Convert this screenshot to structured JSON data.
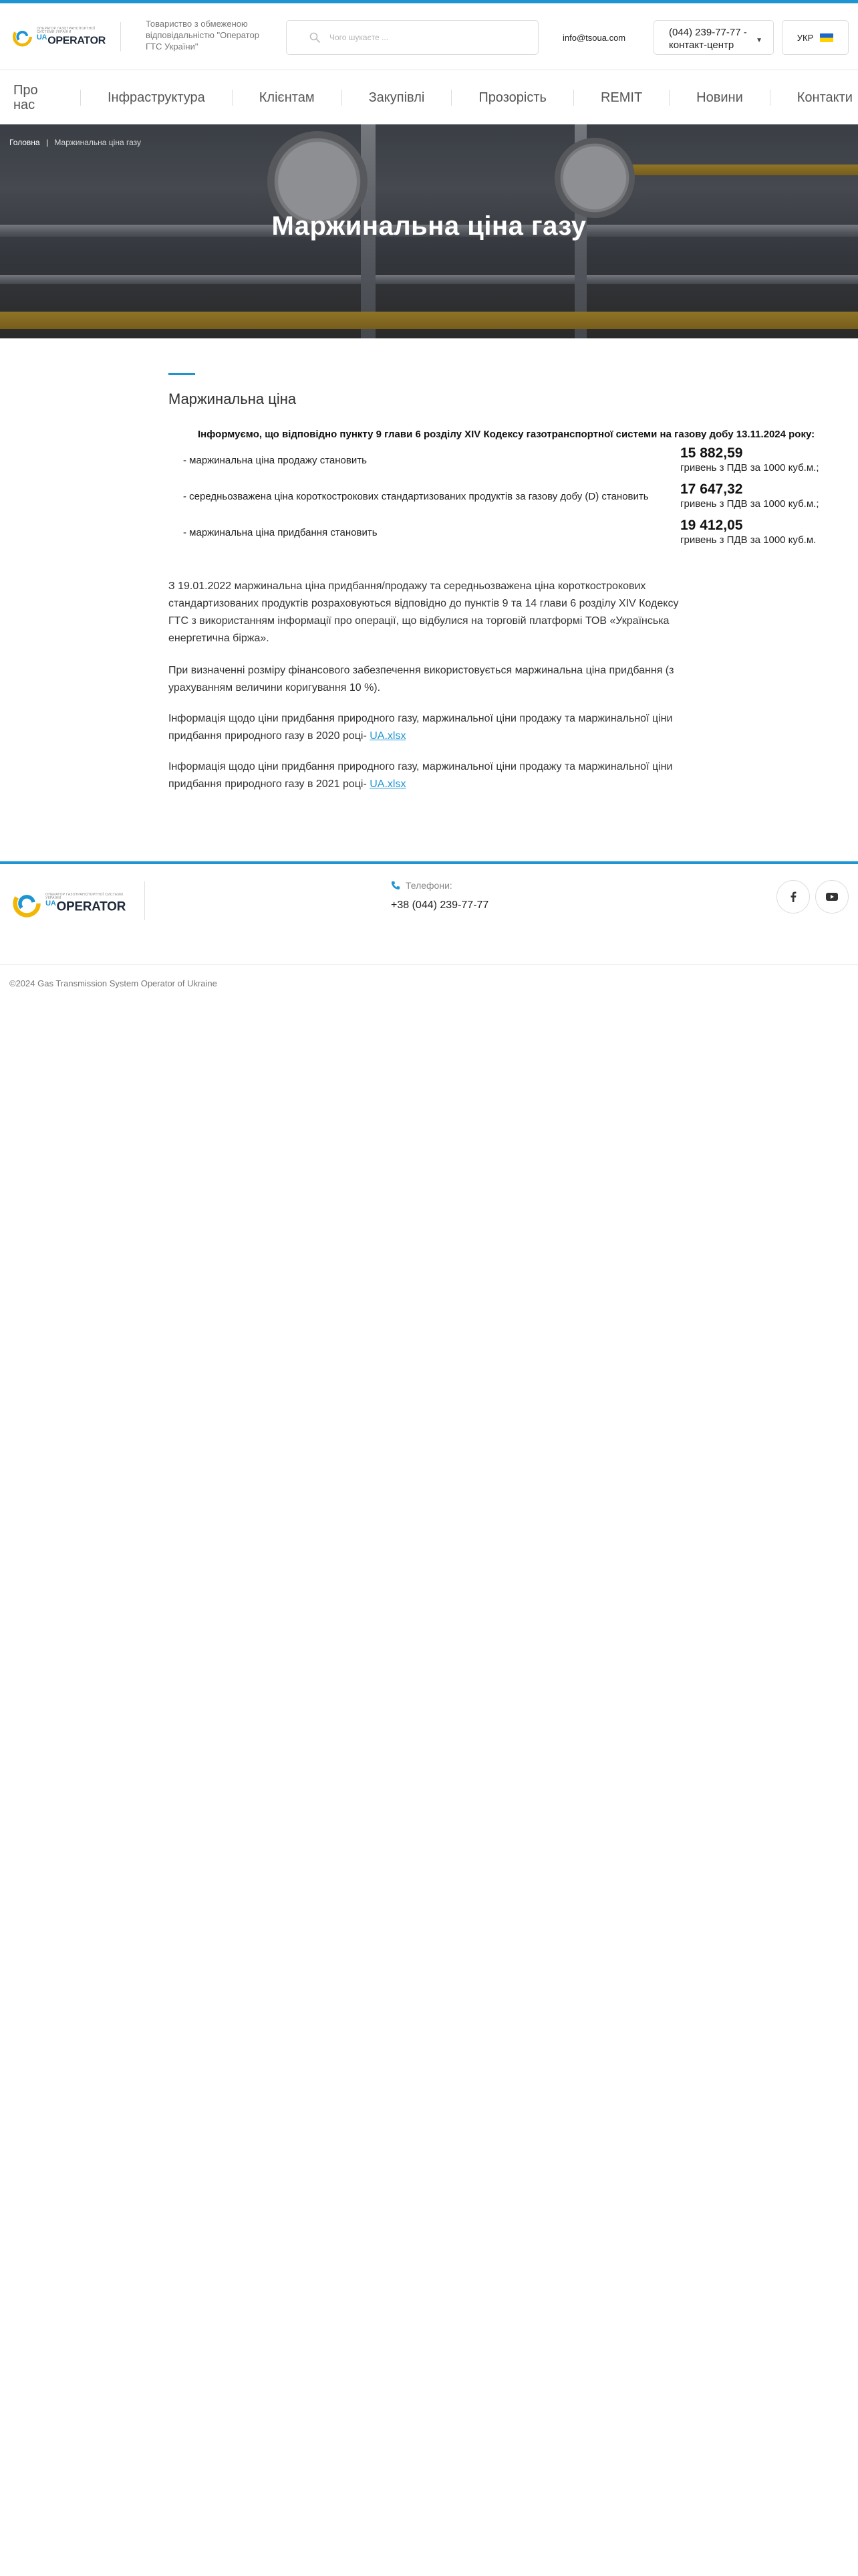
{
  "header": {
    "logo_small": "ОПЕРАТОР ГАЗОТРАНСПОРТНОЇ СИСТЕМИ УКРАЇНИ",
    "logo_ua": "UA",
    "logo_main": "OPERATOR",
    "company_name": "Товариство з обмеженою відповідальністю \"Оператор ГТС України\"",
    "search_placeholder": "Чого шукаєте ...",
    "email": "info@tsoua.com",
    "contact_label": "(044) 239-77-77 - контакт-центр",
    "language": "УКР"
  },
  "nav": {
    "items": [
      "Про нас",
      "Інфраструктура",
      "Клієнтам",
      "Закупівлі",
      "Прозорість",
      "REMIT",
      "Новини",
      "Контакти"
    ]
  },
  "hero": {
    "breadcrumb_home": "Головна",
    "breadcrumb_sep": "|",
    "breadcrumb_current": "Маржинальна ціна газу",
    "title": "Маржинальна ціна газу"
  },
  "content": {
    "section_title": "Маржинальна ціна",
    "intro": "Інформуємо, що відповідно пункту 9 глави 6 розділу XIV Кодексу газотранспортної системи на газову добу 13.11.2024 року:",
    "prices": [
      {
        "label": "- маржинальна ціна продажу становить",
        "value": "15 882,59",
        "unit": "гривень з ПДВ за 1000 куб.м.;"
      },
      {
        "label": "- середньозважена ціна короткострокових стандартизованих продуктів за газову добу (D) становить",
        "value": "17 647,32",
        "unit": "гривень з ПДВ за 1000 куб.м.;"
      },
      {
        "label": "- маржинальна ціна придбання становить",
        "value": "19 412,05",
        "unit": "гривень з ПДВ за 1000 куб.м."
      }
    ],
    "paragraph1": "З 19.01.2022 маржинальна ціна придбання/продажу та середньозважена ціна короткострокових стандартизованих продуктів розраховуються відповідно до пунктів 9 та 14 глави 6 розділу XIV Кодексу ГТС з використанням інформації про операції, що відбулися на торговій платформі ТОВ «Українська енергетична біржа».",
    "paragraph2": "При визначенні розміру фінансового забезпечення використовується маржинальна ціна придбання (з урахуванням величини коригування 10 %).",
    "paragraph3": "Інформація щодо ціни придбання природного газу, маржинальної ціни продажу та маржинальної ціни придбання природного газу в 2020 році-",
    "link3": "UA.xlsx",
    "paragraph4": "Інформація щодо ціни придбання природного газу, маржинальної ціни продажу та маржинальної ціни придбання природного газу в 2021 році-",
    "link4": "UA.xlsx"
  },
  "footer": {
    "phone_label": "Телефони:",
    "phone": "+38 (044) 239-77-77",
    "copyright": "©2024 Gas Transmission System Operator of Ukraine"
  },
  "colors": {
    "accent": "#1e95d3",
    "logo_yellow": "#f2b705"
  }
}
